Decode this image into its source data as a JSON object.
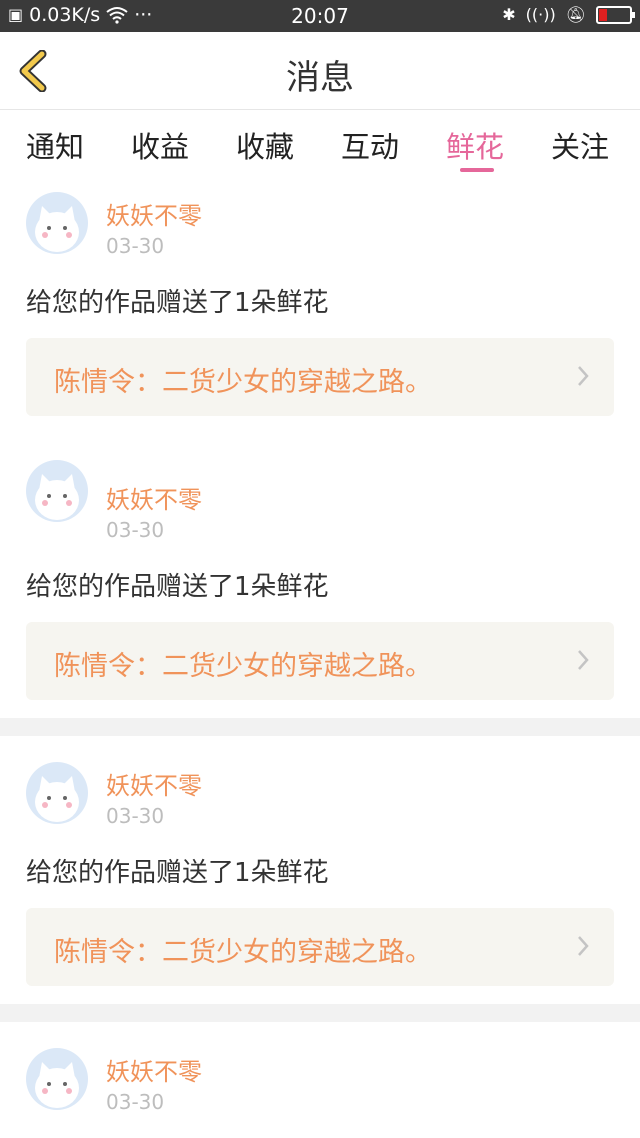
{
  "status_bar": {
    "net_speed": "0.03K/s",
    "more": "···",
    "time": "20:07"
  },
  "header": {
    "title": "消息"
  },
  "tabs": [
    {
      "label": "通知"
    },
    {
      "label": "收益"
    },
    {
      "label": "收藏"
    },
    {
      "label": "互动"
    },
    {
      "label": "鲜花",
      "active": true
    },
    {
      "label": "关注"
    }
  ],
  "messages": [
    {
      "user": "妖妖不零",
      "date": "03-30",
      "text": "给您的作品赠送了1朵鲜花",
      "book": "陈情令：二货少女的穿越之路。"
    },
    {
      "user": "妖妖不零",
      "date": "03-30",
      "text": "给您的作品赠送了1朵鲜花",
      "book": "陈情令：二货少女的穿越之路。"
    },
    {
      "user": "妖妖不零",
      "date": "03-30",
      "text": "给您的作品赠送了1朵鲜花",
      "book": "陈情令：二货少女的穿越之路。"
    },
    {
      "user": "妖妖不零",
      "date": "03-30"
    }
  ],
  "colors": {
    "accent_pink": "#e5679a",
    "username_orange": "#f0935a",
    "back_yellow": "#f2c94c"
  }
}
